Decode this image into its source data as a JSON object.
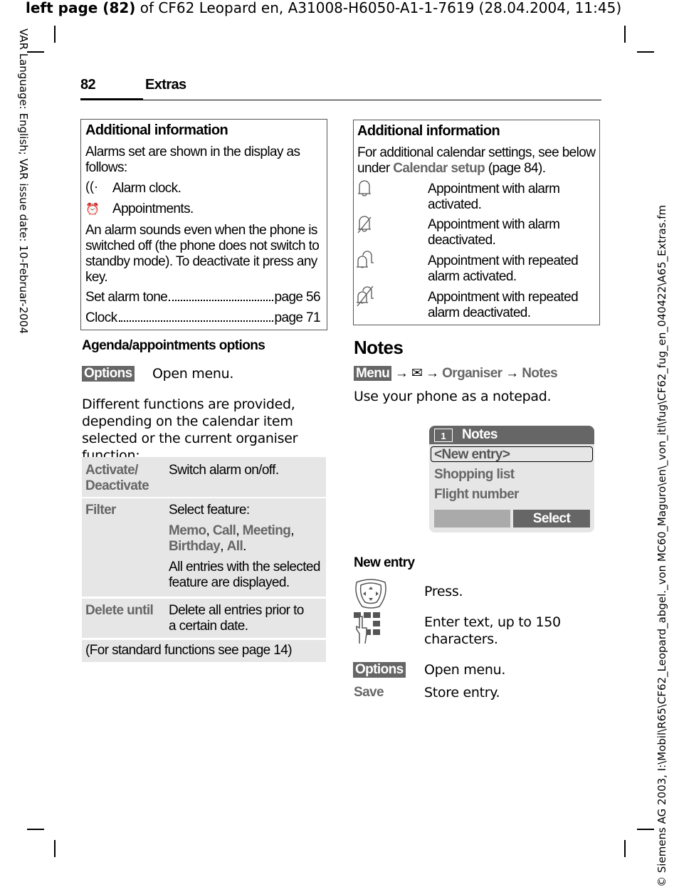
{
  "header_line": {
    "bold": "left page (82)",
    "rest": " of CF62 Leopard en, A31008-H6050-A1-1-7619 (28.04.2004, 11:45)"
  },
  "side_left": "VAR Language: English; VAR issue date: 10-Februar-2004",
  "side_right": "© Siemens AG 2003, I:\\Mobil\\R65\\CF62_Leopard_abgel._von MC60_Maguro\\en\\_von_itl\\fug\\CF62_fug_en_040422\\A65_Extras.fm",
  "page": {
    "number": "82",
    "section": "Extras"
  },
  "left_box": {
    "title": "Additional information",
    "intro": "Alarms set are shown in the display as follows:",
    "items": [
      {
        "icon": "alarm-clock-icon",
        "text": "Alarm clock."
      },
      {
        "icon": "appointment-icon",
        "text": "Appointments."
      }
    ],
    "note": "An alarm sounds even when the phone is switched off (the phone does not switch to standby mode). To deactivate it press any key.",
    "refs": [
      {
        "label": "Set alarm tone",
        "page": "page 56"
      },
      {
        "label": "Clock",
        "page": "page 71"
      }
    ]
  },
  "agenda": {
    "heading": "Agenda/appointments options",
    "options_key": "Options",
    "options_text": "Open menu.",
    "desc": "Different functions are provided, depending on the calendar item selected or the current organiser function:",
    "rows": [
      {
        "key": "Activate/\nDeactivate",
        "val": "Switch alarm on/off."
      },
      {
        "key": "Filter",
        "val": "Select feature:",
        "filters": [
          "Memo",
          ", ",
          "Call",
          ", ",
          "Meeting",
          ",",
          "Birthday",
          ", ",
          "All",
          "."
        ],
        "val2": "All entries with the selected feature are displayed."
      },
      {
        "key": "Delete until",
        "val": "Delete all entries prior to a certain date."
      }
    ],
    "footer": "(For standard functions see page 14)"
  },
  "right_box": {
    "title": "Additional information",
    "intro_a": "For additional calendar settings, see below under ",
    "intro_link": "Calendar setup",
    "intro_b": " (page 84).",
    "items": [
      {
        "icon": "bell-icon",
        "text": "Appointment with alarm activated."
      },
      {
        "icon": "bell-crossed-icon",
        "text": "Appointment with alarm deactivated."
      },
      {
        "icon": "double-bell-icon",
        "text": "Appointment with repeated alarm activated."
      },
      {
        "icon": "double-bell-crossed-icon",
        "text": "Appointment with repeated alarm deactivated."
      }
    ]
  },
  "notes": {
    "heading": "Notes",
    "path": [
      "Menu",
      "→",
      "Organiser",
      "→",
      "Notes"
    ],
    "desc": "Use your phone as a notepad.",
    "screen": {
      "title": "Notes",
      "cal_num": "1",
      "items": [
        "<New entry>",
        "Shopping list",
        "Flight number"
      ],
      "softkey_right": "Select"
    },
    "new_entry": {
      "heading": "New entry",
      "steps": [
        {
          "icon": "nav-key-icon",
          "text": "Press."
        },
        {
          "icon": "keypad-icon",
          "text": "Enter text, up to 150 characters."
        },
        {
          "key": "Options",
          "text": "Open menu."
        },
        {
          "key": "Save",
          "text": "Store entry."
        }
      ]
    }
  }
}
